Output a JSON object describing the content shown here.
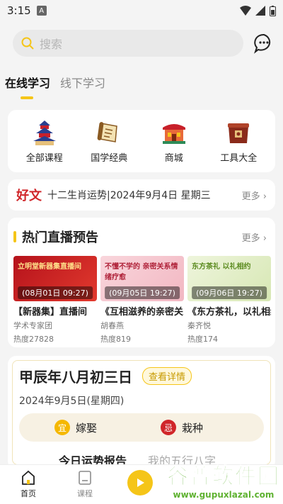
{
  "status_bar": {
    "time": "3:15",
    "badge": "A"
  },
  "search": {
    "placeholder": "搜索"
  },
  "tabs": [
    {
      "label": "在线学习",
      "active": true
    },
    {
      "label": "线下学习",
      "active": false
    }
  ],
  "categories": [
    {
      "label": "全部课程",
      "icon": "temple-icon"
    },
    {
      "label": "国学经典",
      "icon": "scroll-icon"
    },
    {
      "label": "商城",
      "icon": "shop-building-icon"
    },
    {
      "label": "工具大全",
      "icon": "toolbox-icon"
    }
  ],
  "haowen": {
    "tag": "好文",
    "text": "十二生肖运势|2024年9月4日 星期三",
    "more": "更多"
  },
  "live": {
    "title": "热门直播预告",
    "more": "更多",
    "items": [
      {
        "thumb_text": "立明堂新器集直播间",
        "date": "(08月01日 09:27)",
        "name": "【新器集】直播间",
        "author": "学术专家团",
        "heat": "热度27828",
        "bg": "#c8202a",
        "fg": "#ffe08a"
      },
      {
        "thumb_text": "不懂不学的 亲密关系情绪疗愈",
        "date": "(09月05日 19:27)",
        "name": "《互相滋养的亲密关系》",
        "author": "胡春燕",
        "heat": "热度819",
        "bg": "#f7c9d0",
        "fg": "#b0233a"
      },
      {
        "thumb_text": "东方茶礼 以礼相约",
        "date": "(09月06日 19:27)",
        "name": "《东方茶礼，以礼相约》",
        "author": "秦齐悦",
        "heat": "热度174",
        "bg": "#e6efcf",
        "fg": "#5a8a1e"
      }
    ]
  },
  "calendar": {
    "lunar": "甲辰年八月初三日",
    "detail_button": "查看详情",
    "solar": "2024年9月5日(星期四)",
    "yi": {
      "badge": "宜",
      "text": "嫁娶",
      "color": "#f5b800"
    },
    "ji": {
      "badge": "忌",
      "text": "栽种",
      "color": "#d0262a"
    },
    "fortune_title": "今日运势报告",
    "fortune_sub": "我的五行八字"
  },
  "bottom_nav": [
    {
      "label": "首页",
      "active": true
    },
    {
      "label": "课程",
      "active": false
    }
  ],
  "watermark": {
    "big": "谷普软件园",
    "small": "www.gupuxlazal.com"
  },
  "colors": {
    "accent": "#f5c518",
    "red": "#d0262a"
  }
}
